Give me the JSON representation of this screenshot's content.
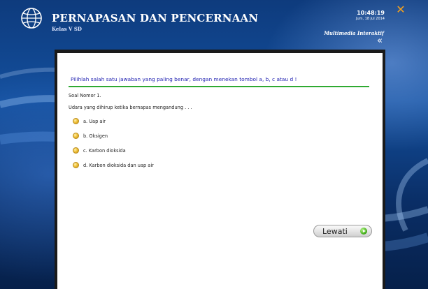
{
  "header": {
    "title": "PERNAPASAN DAN PENCERNAAN",
    "subtitle": "Kelas V SD",
    "time": "10:48:19",
    "date": "Jum, 18 Jul 2014",
    "brand": "Multimedia Interaktif",
    "close_icon": "close-icon",
    "back_icon": "double-chevron-left-icon",
    "close_symbol": "✕",
    "back_symbol": "«"
  },
  "quiz": {
    "instruction": "Pilihlah salah satu jawaban yang paling benar, dengan menekan tombol a, b, c atau d !",
    "number_label": "Soal Nomor 1.",
    "question": "Udara yang dihirup ketika bernapas mengandung . . .",
    "options": [
      {
        "label": "a.  Uap air"
      },
      {
        "label": "b.  Oksigen"
      },
      {
        "label": "c.  Karbon dioksida"
      },
      {
        "label": "d.  Karbon dioksida dan uap air"
      }
    ],
    "skip_label": "Lewati"
  },
  "colors": {
    "instruction_text": "#1e1fb0",
    "instruction_underline": "#2faa32",
    "close_icon": "#f7a21b",
    "background": "#0c2f63"
  }
}
